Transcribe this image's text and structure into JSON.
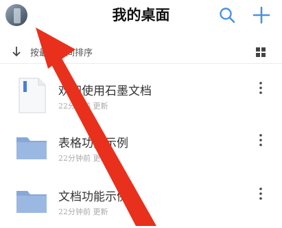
{
  "header": {
    "title": "我的桌面",
    "icons": [
      "avatar",
      "search-icon",
      "plus-icon"
    ]
  },
  "sort": {
    "label": "按最近时间排序",
    "icons": [
      "arrow-down-icon",
      "grid-view-icon"
    ]
  },
  "items": [
    {
      "name": "欢迎使用石墨文档",
      "meta": "22分钟前 更新",
      "type": "document",
      "icon": "document-icon"
    },
    {
      "name": "表格功能示例",
      "meta": "22分钟前 更新",
      "type": "folder",
      "icon": "folder-icon"
    },
    {
      "name": "文档功能示例",
      "meta": "22分钟前 更新",
      "type": "folder",
      "icon": "folder-icon"
    }
  ],
  "colors": {
    "accent": "#4a90e2",
    "folder": "#86a8d8",
    "annotation_arrow": "#e8301c"
  }
}
